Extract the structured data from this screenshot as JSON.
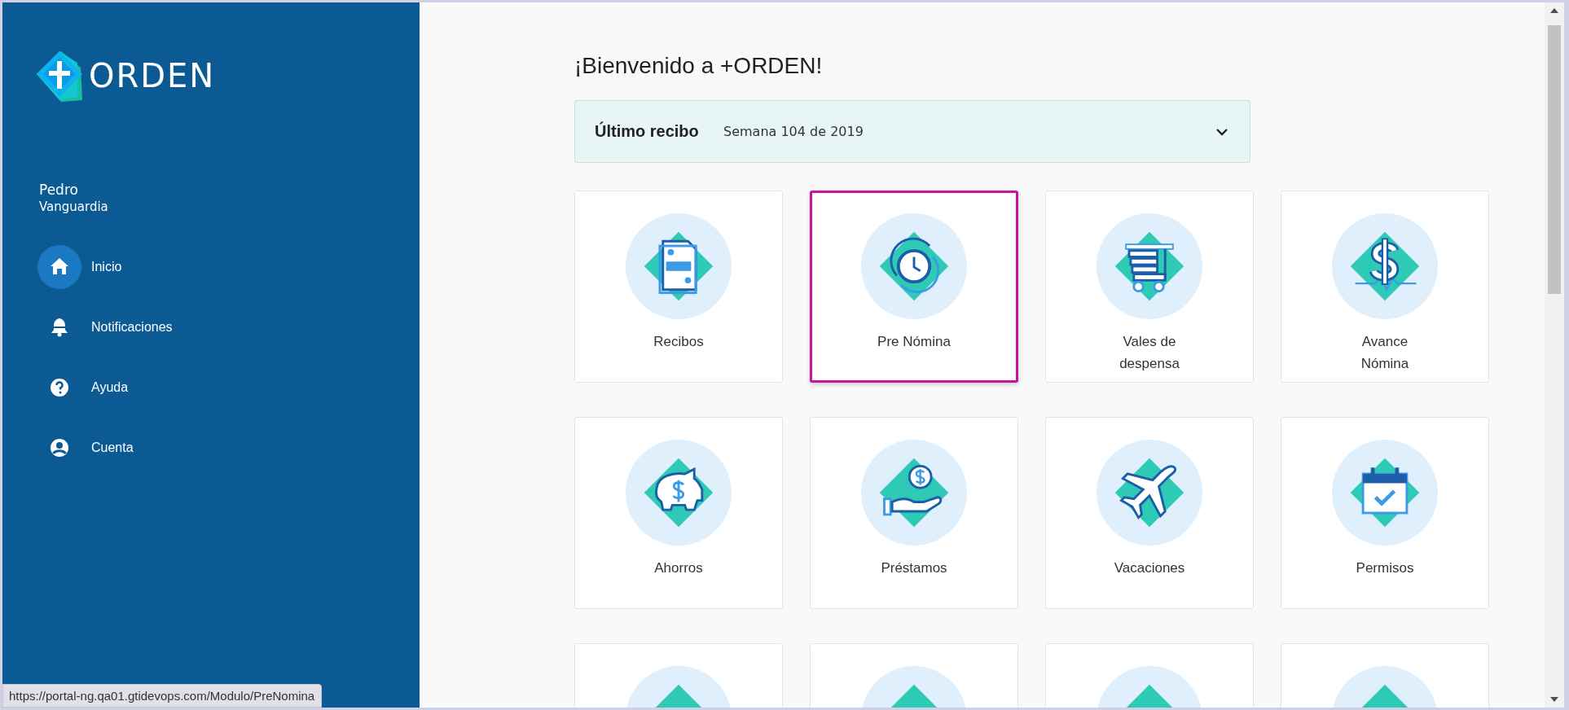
{
  "sidebar": {
    "logo_text": "ORDEN",
    "user": {
      "first_name": "Pedro",
      "last_name": "Vanguardia"
    },
    "items": [
      {
        "label": "Inicio",
        "selected": true
      },
      {
        "label": "Notificaciones",
        "selected": false
      },
      {
        "label": "Ayuda",
        "selected": false
      },
      {
        "label": "Cuenta",
        "selected": false
      }
    ]
  },
  "main": {
    "title": "¡Bienvenido a +ORDEN!",
    "last_receipt": {
      "label": "Último recibo",
      "value": "Semana 104 de 2019",
      "expanded": false
    },
    "tiles": [
      {
        "label": "Recibos",
        "selected": false
      },
      {
        "label": "Pre Nómina",
        "selected": true
      },
      {
        "label": "Vales de despensa",
        "selected": false
      },
      {
        "label": "Avance Nómina",
        "selected": false
      },
      {
        "label": "Ahorros",
        "selected": false
      },
      {
        "label": "Préstamos",
        "selected": false
      },
      {
        "label": "Vacaciones",
        "selected": false
      },
      {
        "label": "Permisos",
        "selected": false
      },
      {
        "selected": false
      },
      {
        "selected": false
      },
      {
        "selected": false
      },
      {
        "selected": false
      }
    ]
  },
  "status_bar": {
    "url": "https://portal-ng.qa01.gtidevops.com/Modulo/PreNomina"
  }
}
